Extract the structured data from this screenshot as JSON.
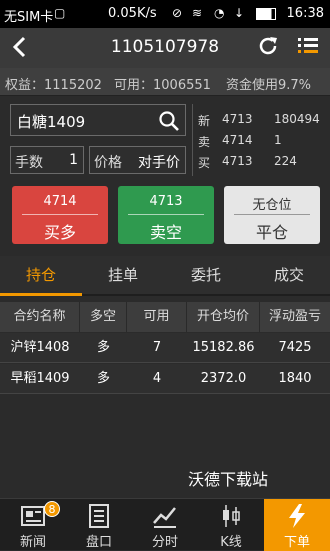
{
  "status_bar": {
    "carrier": "无SIM卡",
    "speed": "0.05K/s",
    "time": "16:38"
  },
  "header": {
    "title": "1105107978"
  },
  "account": {
    "equity": "权益：1115202",
    "available": "可用：1006551",
    "usage": "资金使用9.7%"
  },
  "order": {
    "symbol": "白糖1409",
    "qty_label": "手数",
    "qty_value": "1",
    "price_label": "价格",
    "price_value": "对手价"
  },
  "quotes": [
    {
      "side": "新",
      "price": "4713",
      "volume": "180494"
    },
    {
      "side": "卖",
      "price": "4714",
      "volume": "1"
    },
    {
      "side": "买",
      "price": "4713",
      "volume": "224"
    }
  ],
  "actions": {
    "buy": {
      "price": "4714",
      "label": "买多"
    },
    "sell": {
      "price": "4713",
      "label": "卖空"
    },
    "close": {
      "price": "无仓位",
      "label": "平仓"
    }
  },
  "tabs": [
    "持仓",
    "挂单",
    "委托",
    "成交"
  ],
  "table": {
    "headers": [
      "合约名称",
      "多空",
      "可用",
      "开仓均价",
      "浮动盈亏"
    ],
    "rows": [
      [
        "沪锌1408",
        "多",
        "7",
        "15182.86",
        "7425"
      ],
      [
        "早稻1409",
        "多",
        "4",
        "2372.0",
        "1840"
      ]
    ]
  },
  "watermark": "沃德下载站",
  "bottom_nav": {
    "news": "新闻",
    "news_badge": "8",
    "market": "盘口",
    "timeshare": "分时",
    "kline": "K线",
    "order": "下单"
  },
  "colors": {
    "accent": "#f39800",
    "buy": "#d9453f",
    "sell": "#2f9a4f",
    "close": "#e6e6e6"
  }
}
